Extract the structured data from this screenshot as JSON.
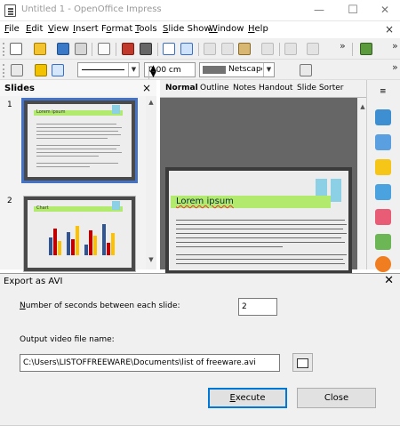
{
  "window": {
    "title": "Untitled 1 - OpenOffice Impress",
    "minimize": "—",
    "maximize": "☐",
    "close": "✕"
  },
  "menubar": {
    "items": [
      "File",
      "Edit",
      "View",
      "Insert",
      "Format",
      "Tools",
      "Slide Show",
      "Window",
      "Help"
    ],
    "accelerators": [
      "F",
      "E",
      "V",
      "I",
      "o",
      "T",
      "S",
      "W",
      "H"
    ],
    "close": "×"
  },
  "toolbar2": {
    "line_width": "0.00 cm",
    "color_name": "Netscape"
  },
  "slides_pane": {
    "title": "Slides",
    "close": "×",
    "slides": [
      {
        "number": "1",
        "title": "Lorem ipsum",
        "selected": true
      },
      {
        "number": "2",
        "title": "Chart",
        "selected": false
      }
    ]
  },
  "view_tabs": [
    "Normal",
    "Outline",
    "Notes",
    "Handout",
    "Slide Sorter"
  ],
  "active_tab": "Normal",
  "current_slide": {
    "title": "Lorem ipsum"
  },
  "dialog": {
    "title": "Export as AVI",
    "close": "✕",
    "seconds_label": "Number of seconds between each slide:",
    "seconds_accel": "N",
    "seconds_value": "2",
    "output_label": "Output video file name:",
    "output_value": "C:\\Users\\LISTOFFREEWARE\\Documents\\list of freeware.avi",
    "execute_label": "Execute",
    "execute_accel": "E",
    "close_label": "Close"
  },
  "colors": {
    "accent": "#0078d7",
    "slide_bar": "#b2ea6d",
    "slide_deco": "#8cd0e6",
    "selection": "#4472c4"
  }
}
